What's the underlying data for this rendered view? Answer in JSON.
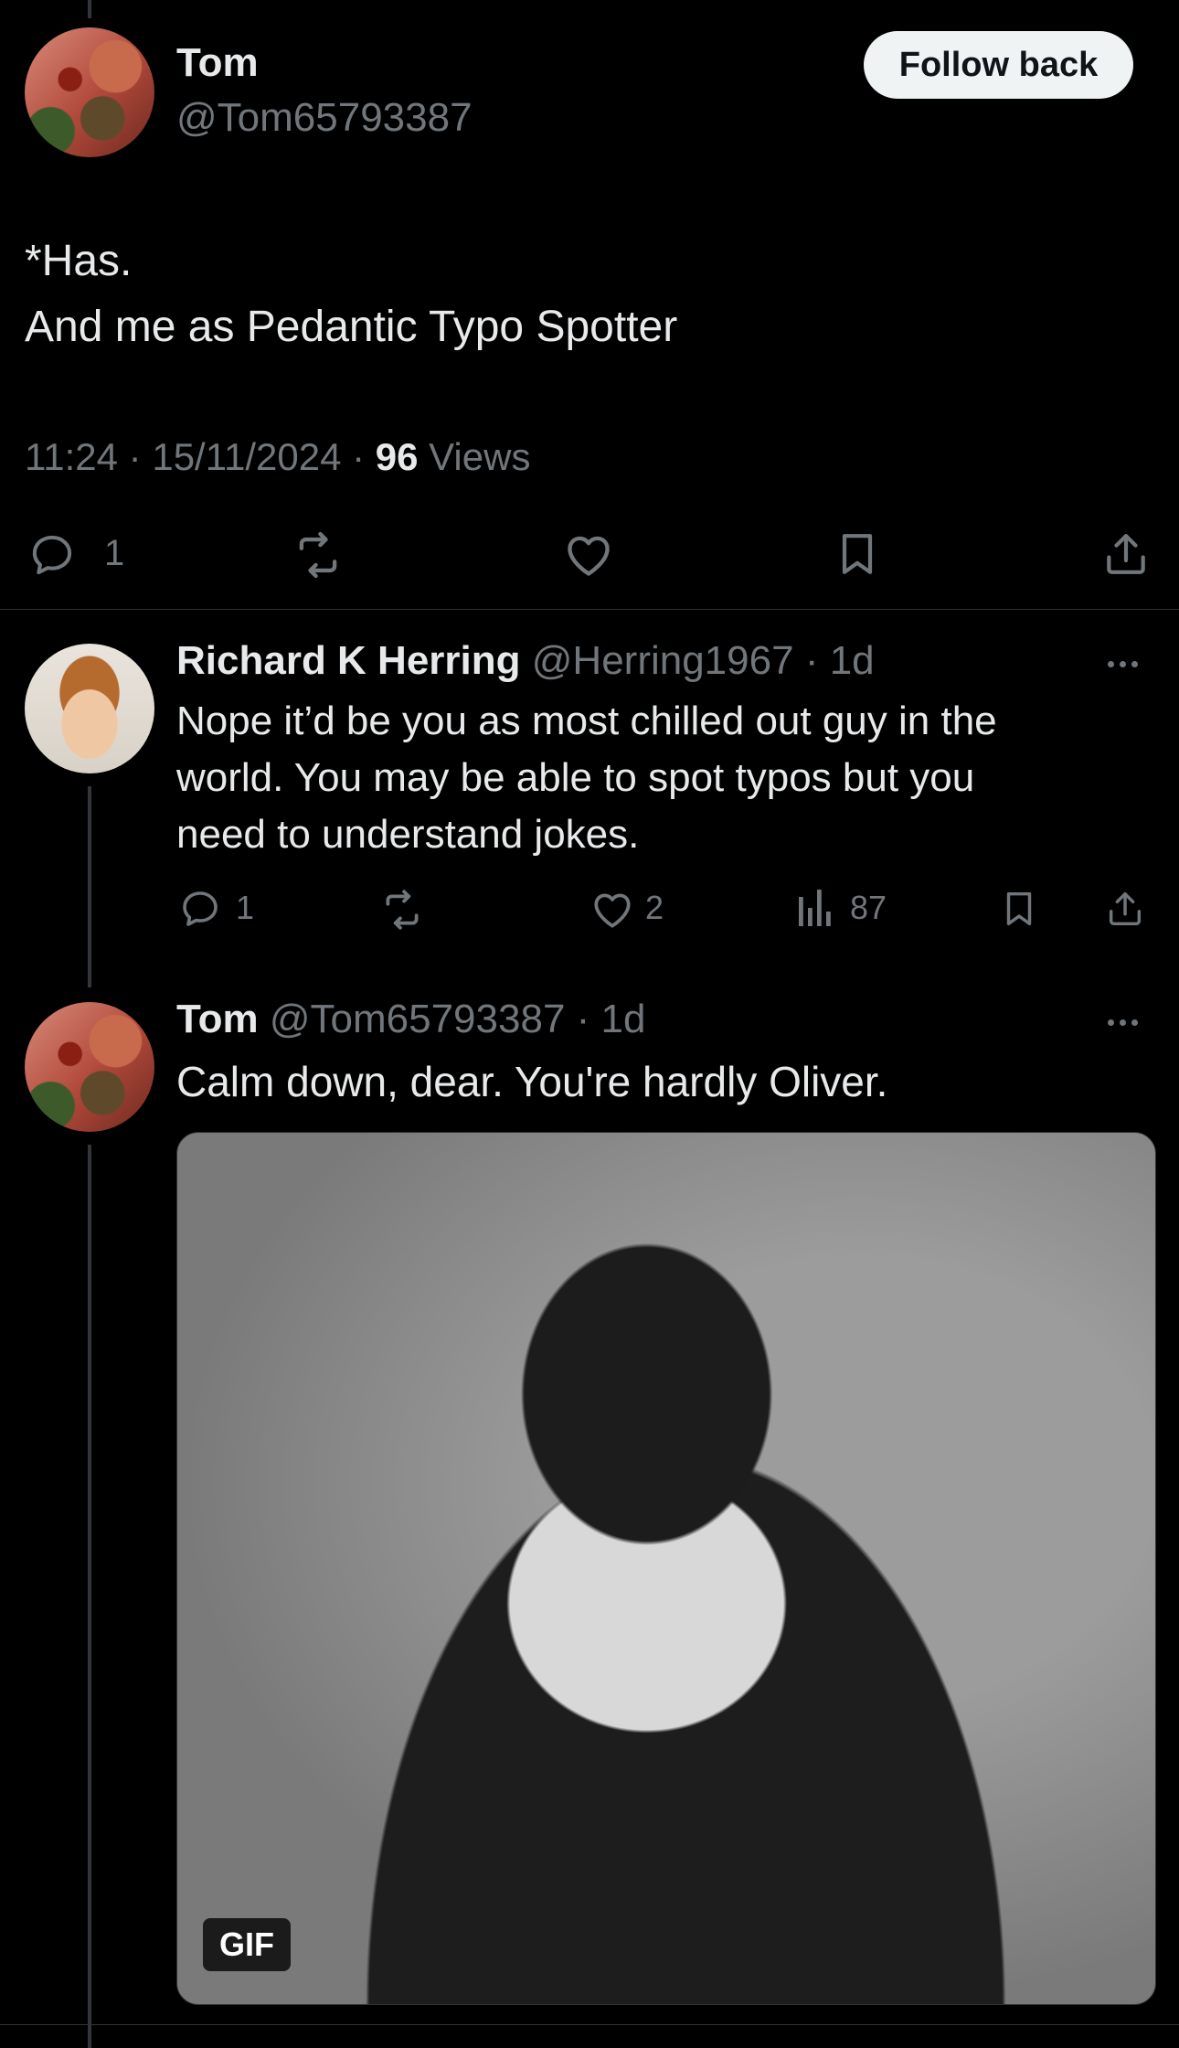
{
  "main_tweet": {
    "display_name": "Tom",
    "handle": "@Tom65793387",
    "follow_label": "Follow back",
    "text_line1": "*Has.",
    "text_line2": "And me as Pedantic Typo Spotter",
    "time": "11:24",
    "date": "15/11/2024",
    "views_count": "96",
    "views_label": "Views",
    "reply_count": "1"
  },
  "reply1": {
    "display_name": "Richard K Herring",
    "handle": "@Herring1967",
    "age": "1d",
    "text_line1": "Nope it’d be you as most chilled out guy in the",
    "text_line2": "world. You may be able to spot typos but you",
    "text_line3": "need to understand jokes.",
    "reply_count": "1",
    "like_count": "2",
    "view_count": "87"
  },
  "reply2": {
    "display_name": "Tom",
    "handle": "@Tom65793387",
    "age": "1d",
    "text": "Calm down, dear. You're hardly Oliver.",
    "gif_label": "GIF"
  },
  "separators": {
    "dot": "·"
  }
}
